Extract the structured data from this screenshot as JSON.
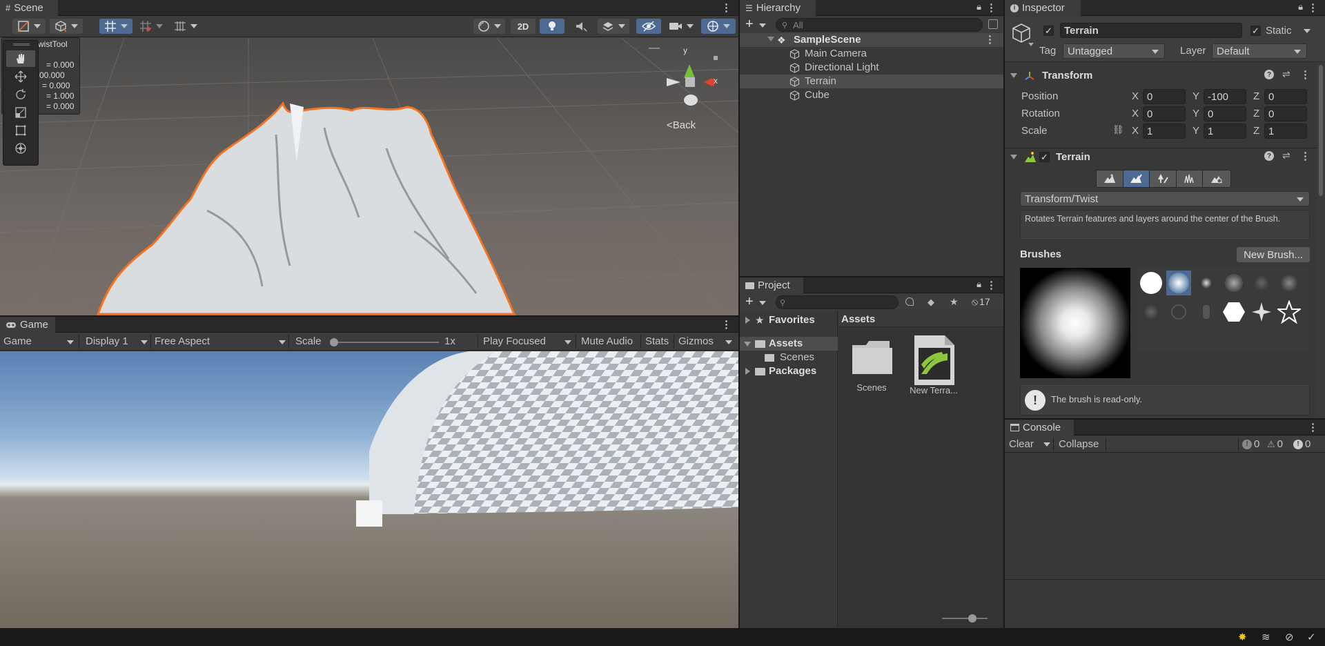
{
  "scene": {
    "tab_label": "Scene",
    "toolbar": {
      "mode_2d": "2D"
    },
    "overlay": {
      "title": "wistTool",
      "values": [
        "= 0.000",
        "00.000",
        "= 0.000",
        "= 1.000",
        "= 0.000"
      ]
    },
    "gizmo": {
      "y_label": "y",
      "x_label": "x",
      "back_label": "Back"
    }
  },
  "game": {
    "tab_label": "Game",
    "toolbar": {
      "game_dropdown": "Game",
      "display_dropdown": "Display 1",
      "aspect_dropdown": "Free Aspect",
      "scale_label": "Scale",
      "scale_value": "1x",
      "play_mode_dropdown": "Play Focused",
      "mute_audio": "Mute Audio",
      "stats": "Stats",
      "gizmos": "Gizmos"
    }
  },
  "hierarchy": {
    "tab_label": "Hierarchy",
    "search_placeholder": "All",
    "scene_name": "SampleScene",
    "items": [
      {
        "label": "Main Camera"
      },
      {
        "label": "Directional Light"
      },
      {
        "label": "Terrain"
      },
      {
        "label": "Cube"
      }
    ],
    "selected_index": 2
  },
  "project": {
    "tab_label": "Project",
    "hidden_count": "17",
    "tree": {
      "favorites": "Favorites",
      "assets": "Assets",
      "scenes": "Scenes",
      "packages": "Packages"
    },
    "breadcrumb": "Assets",
    "assets": [
      {
        "label": "Scenes",
        "icon": "folder-icon"
      },
      {
        "label": "New Terra...",
        "icon": "terrain-data-icon"
      }
    ],
    "zoom_level": 0.4
  },
  "inspector": {
    "tab_label": "Inspector",
    "object_name": "Terrain",
    "static_label": "Static",
    "tag_label": "Tag",
    "tag_value": "Untagged",
    "layer_label": "Layer",
    "layer_value": "Default",
    "transform": {
      "title": "Transform",
      "position_label": "Position",
      "rotation_label": "Rotation",
      "scale_label": "Scale",
      "axis_x": "X",
      "axis_y": "Y",
      "axis_z": "Z",
      "position": {
        "x": "0",
        "y": "-100",
        "z": "0"
      },
      "rotation": {
        "x": "0",
        "y": "0",
        "z": "0"
      },
      "scale": {
        "x": "1",
        "y": "1",
        "z": "1"
      }
    },
    "terrain": {
      "title": "Terrain",
      "tool_dropdown": "Transform/Twist",
      "description": "Rotates Terrain features and layers around the center of the Brush.",
      "brushes_label": "Brushes",
      "new_brush": "New Brush...",
      "readonly_note": "The brush is read-only."
    }
  },
  "console": {
    "tab_label": "Console",
    "clear": "Clear",
    "collapse": "Collapse",
    "info_count": "0",
    "warning_count": "0",
    "error_count": "0"
  },
  "colors": {
    "selection_outline": "#f37321",
    "active_tool": "#4d6a93",
    "panel_bg": "#383838",
    "terrain_icon": "#8dc63f"
  }
}
